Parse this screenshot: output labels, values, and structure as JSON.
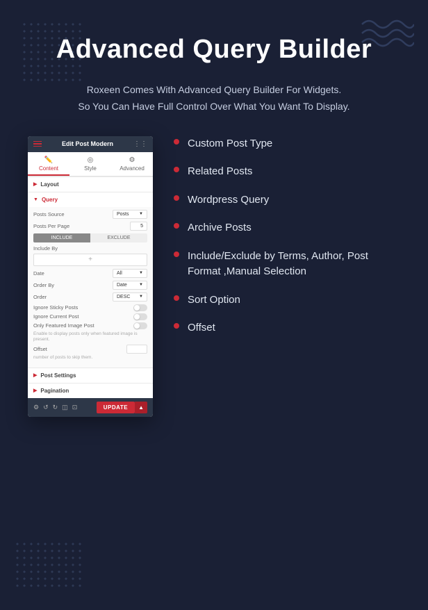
{
  "background": {
    "color": "#1a2035"
  },
  "page": {
    "title": "Advanced Query Builder",
    "subtitle_line1": "Roxeen Comes With Advanced Query Builder For Widgets.",
    "subtitle_line2": "So You Can Have Full Control Over What You Want To Display."
  },
  "features": [
    {
      "id": "custom-post-type",
      "text": "Custom Post Type"
    },
    {
      "id": "related-posts",
      "text": "Related Posts"
    },
    {
      "id": "wordpress-query",
      "text": "Wordpress Query"
    },
    {
      "id": "archive-posts",
      "text": "Archive Posts"
    },
    {
      "id": "include-exclude",
      "text": "Include/Exclude by Terms, Author, Post Format ,Manual Selection"
    },
    {
      "id": "sort-option",
      "text": "Sort Option"
    },
    {
      "id": "offset",
      "text": "Offset"
    }
  ],
  "widget": {
    "header_title": "Edit Post Modern",
    "tabs": [
      {
        "label": "Content",
        "icon": "✏️",
        "active": true
      },
      {
        "label": "Style",
        "icon": "⓪",
        "active": false
      },
      {
        "label": "Advanced",
        "icon": "⚙️",
        "active": false
      }
    ],
    "sections": {
      "layout": "Layout",
      "query": "Query"
    },
    "fields": {
      "posts_source": {
        "label": "Posts Source",
        "value": "Posts"
      },
      "posts_per_page": {
        "label": "Posts Per Page",
        "value": "5"
      },
      "include_btn": "INCLUDE",
      "exclude_btn": "EXCLUDE",
      "include_by": "Include By",
      "date": {
        "label": "Date",
        "value": "All"
      },
      "order_by": {
        "label": "Order By",
        "value": "Date"
      },
      "order": {
        "label": "Order",
        "value": "DESC"
      },
      "ignore_sticky": "Ignore Sticky Posts",
      "ignore_current": "Ignore Current Post",
      "only_featured": "Only Featured Image Post",
      "only_featured_note": "Enable to display posts only when featured image is present.",
      "offset": {
        "label": "Offset",
        "value": ""
      },
      "offset_note": "number of posts to skip them."
    },
    "post_settings": "Post Settings",
    "pagination": "Pagination",
    "footer": {
      "update_btn": "UPDATE"
    }
  }
}
